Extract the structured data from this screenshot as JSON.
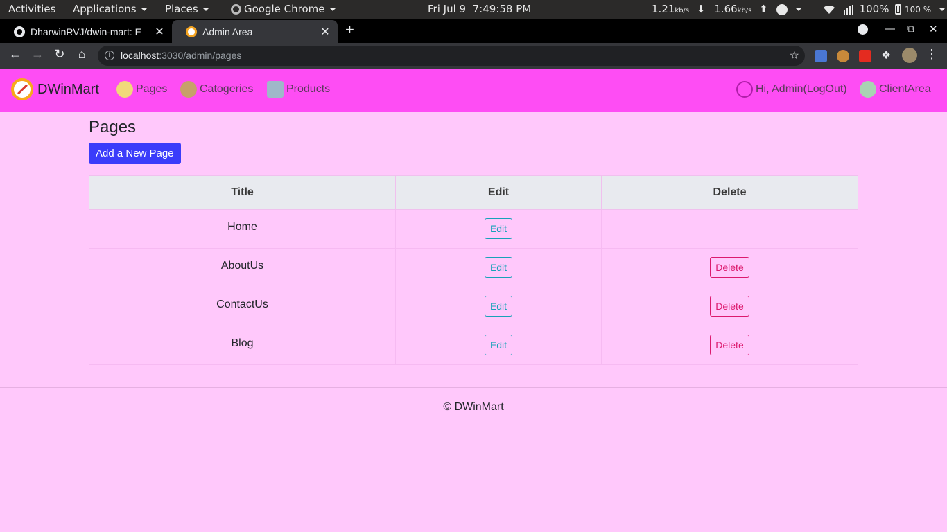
{
  "system_bar": {
    "activities": "Activities",
    "applications": "Applications",
    "places": "Places",
    "app_name": "Google Chrome",
    "date": "Fri Jul 9",
    "time": "7:49:58 PM",
    "net_down": "1.21",
    "net_down_unit": "kb/s",
    "net_up": "1.66",
    "net_up_unit": "kb/s",
    "volume": "100%",
    "battery": "100 %"
  },
  "browser": {
    "tabs": [
      {
        "title": "DharwinRVJ/dwin-mart: E",
        "active": false
      },
      {
        "title": "Admin Area",
        "active": true
      }
    ],
    "url_host": "localhost",
    "url_path": ":3030/admin/pages"
  },
  "app_nav": {
    "brand": "DWinMart",
    "links": [
      "Pages",
      "Catogeries",
      "Products"
    ],
    "user_link": "Hi, Admin(LogOut)",
    "client_link": "ClientArea"
  },
  "main": {
    "heading": "Pages",
    "add_button": "Add a New Page",
    "table": {
      "headers": [
        "Title",
        "Edit",
        "Delete"
      ],
      "rows": [
        {
          "title": "Home",
          "edit": "Edit",
          "delete": ""
        },
        {
          "title": "AboutUs",
          "edit": "Edit",
          "delete": "Delete"
        },
        {
          "title": "ContactUs",
          "edit": "Edit",
          "delete": "Delete"
        },
        {
          "title": "Blog",
          "edit": "Edit",
          "delete": "Delete"
        }
      ]
    }
  },
  "footer": {
    "text": "© DWinMart"
  },
  "colors": {
    "navbar_bg": "#fe4df4",
    "page_bg": "#ffc8fb",
    "primary_button": "#3a3cfa",
    "edit_outline": "#17a2b8",
    "delete_outline": "#dc1a6e"
  }
}
